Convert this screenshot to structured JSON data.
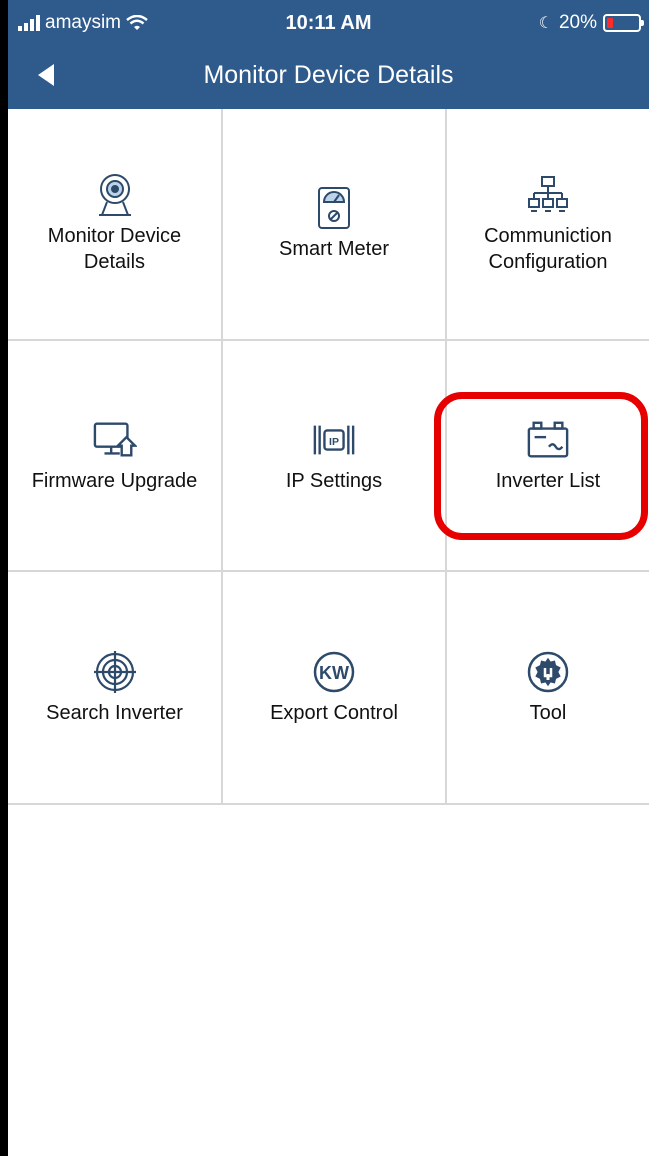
{
  "status": {
    "carrier": "amaysim",
    "time": "10:11 AM",
    "battery": "20%",
    "battery_level": 0.2
  },
  "nav": {
    "title": "Monitor Device Details"
  },
  "menu": {
    "items": [
      {
        "id": "monitor",
        "label": "Monitor Device Details",
        "icon": "webcam-icon"
      },
      {
        "id": "meter",
        "label": "Smart Meter",
        "icon": "meter-icon"
      },
      {
        "id": "comm",
        "label": "Communiction Configuration",
        "icon": "network-icon"
      },
      {
        "id": "firmware",
        "label": "Firmware Upgrade",
        "icon": "upload-monitor-icon"
      },
      {
        "id": "ip",
        "label": "IP Settings",
        "icon": "ip-icon"
      },
      {
        "id": "inverter",
        "label": "Inverter List",
        "icon": "inverter-icon",
        "highlighted": true
      },
      {
        "id": "search",
        "label": "Search Inverter",
        "icon": "target-icon"
      },
      {
        "id": "export",
        "label": "Export Control",
        "icon": "kw-icon"
      },
      {
        "id": "tool",
        "label": "Tool",
        "icon": "gear-wrench-icon"
      }
    ]
  },
  "colors": {
    "header": "#2e5a8c",
    "highlight": "#e60000",
    "grid_line": "#d7d7d7"
  }
}
